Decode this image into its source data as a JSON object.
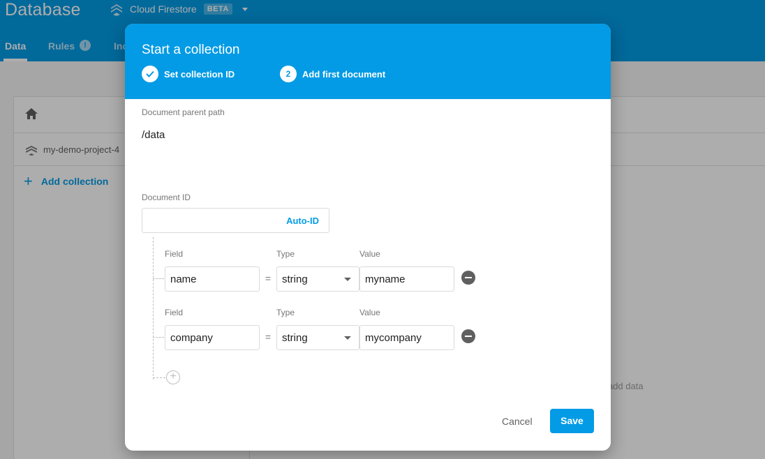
{
  "app": {
    "title": "Database",
    "product": "Cloud Firestore",
    "product_badge": "BETA",
    "tabs": [
      {
        "label": "Data"
      },
      {
        "label": "Rules"
      },
      {
        "label": "Ind"
      }
    ],
    "rules_badge": "!",
    "project_name": "my-demo-project-4",
    "add_collection_label": "Add collection",
    "hint_text": "ust add data",
    "colors": {
      "brand": "#039be5",
      "text": "#212121"
    }
  },
  "dialog": {
    "title": "Start a collection",
    "steps": [
      {
        "label": "Set collection ID",
        "state": "done",
        "icon": "check-icon"
      },
      {
        "label": "Add first document",
        "state": "current",
        "number": "2"
      }
    ],
    "parent_path_label": "Document parent path",
    "parent_path": "/data",
    "document_id_label": "Document ID",
    "document_id_value": "",
    "auto_id_label": "Auto-ID",
    "fields": [
      {
        "field_label": "Field",
        "type_label": "Type",
        "value_label": "Value",
        "field": "name",
        "type": "string",
        "value": "myname"
      },
      {
        "field_label": "Field",
        "type_label": "Type",
        "value_label": "Value",
        "field": "company",
        "type": "string",
        "value": "mycompany"
      }
    ],
    "equals": "=",
    "cancel_label": "Cancel",
    "save_label": "Save"
  }
}
